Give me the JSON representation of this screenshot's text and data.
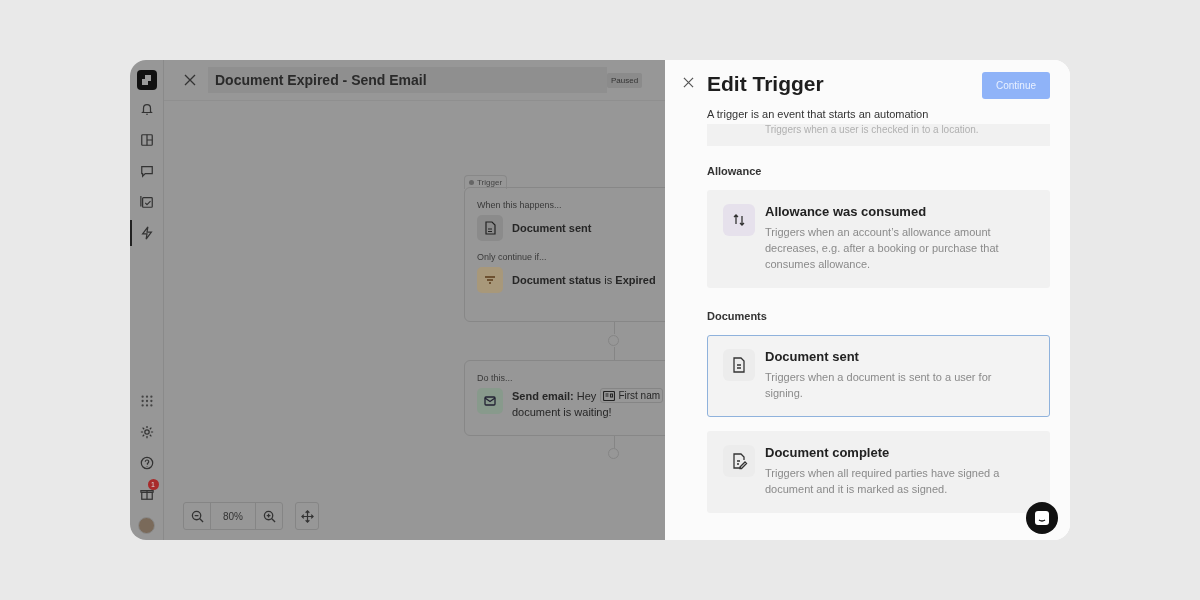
{
  "sidebar": {
    "items": [
      {
        "kind": "bell",
        "selected": false
      },
      {
        "kind": "layout",
        "selected": false
      },
      {
        "kind": "chat",
        "selected": false
      },
      {
        "kind": "check",
        "selected": false
      },
      {
        "kind": "bolt",
        "selected": true
      }
    ],
    "bottom_items": [
      {
        "kind": "apps"
      },
      {
        "kind": "gear"
      },
      {
        "kind": "help"
      },
      {
        "kind": "gift",
        "badge": "1"
      },
      {
        "kind": "avatar"
      }
    ]
  },
  "header": {
    "title": "Document Expired - Send Email",
    "status": "Paused"
  },
  "canvas": {
    "trigger": {
      "tag": "Trigger",
      "when_label": "When this happens...",
      "event": "Document sent",
      "condition_label": "Only continue if...",
      "condition": "**Document status** is **Expired**"
    },
    "action": {
      "label": "Do this...",
      "lead": "**Send email:** Hey",
      "token": "First nam",
      "rest": "document is waiting!"
    },
    "zoom": "80%"
  },
  "panel": {
    "title": "Edit Trigger",
    "subtitle": "A trigger is an event that starts an automation",
    "continue": {
      "label": "Continue",
      "disabled": true
    },
    "partial_card": {
      "description": "Triggers when a user is checked in to a location."
    },
    "sections": [
      {
        "heading": "Allowance",
        "options": [
          {
            "kind": "arrows",
            "title": "Allowance was consumed",
            "description": "Triggers when an account’s allowance amount decreases, e.g. after a booking or purchase that consumes allowance.",
            "selected": false
          }
        ]
      },
      {
        "heading": "Documents",
        "options": [
          {
            "kind": "document",
            "title": "Document sent",
            "description": "Triggers when a document is sent to a user for signing.",
            "selected": true
          },
          {
            "kind": "signed",
            "title": "Document complete",
            "description": "Triggers when all required parties have signed a document and it is marked as signed.",
            "selected": false
          }
        ]
      }
    ]
  }
}
